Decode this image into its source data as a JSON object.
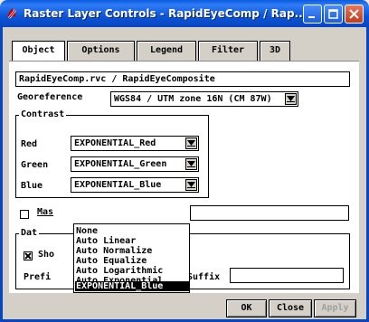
{
  "window": {
    "title": "Raster Layer Controls - RapidEyeComp / Rap..."
  },
  "tabs": [
    "Object",
    "Options",
    "Legend",
    "Filter",
    "3D"
  ],
  "object": {
    "path": "RapidEyeComp.rvc / RapidEyeComposite"
  },
  "georeference": {
    "label": "Georeference",
    "value": "WGS84 / UTM zone 16N (CM 87W)"
  },
  "contrast": {
    "title": "Contrast",
    "rows": [
      {
        "label": "Red",
        "value": "EXPONENTIAL_Red"
      },
      {
        "label": "Green",
        "value": "EXPONENTIAL_Green"
      },
      {
        "label": "Blue",
        "value": "EXPONENTIAL_Blue"
      }
    ]
  },
  "dropdown": {
    "items": [
      "None",
      "Auto Linear",
      "Auto Normalize",
      "Auto Equalize",
      "Auto Logarithmic",
      "Auto Exponential",
      "EXPONENTIAL_Blue"
    ],
    "selected": "EXPONENTIAL_Blue"
  },
  "mask": {
    "label": "Mas"
  },
  "datatips": {
    "title": "Dat",
    "show_label": "Sho",
    "prefix_label": "Prefi",
    "suffix_label": "Suffix"
  },
  "buttons": {
    "ok": "OK",
    "close": "Close",
    "apply": "Apply"
  }
}
